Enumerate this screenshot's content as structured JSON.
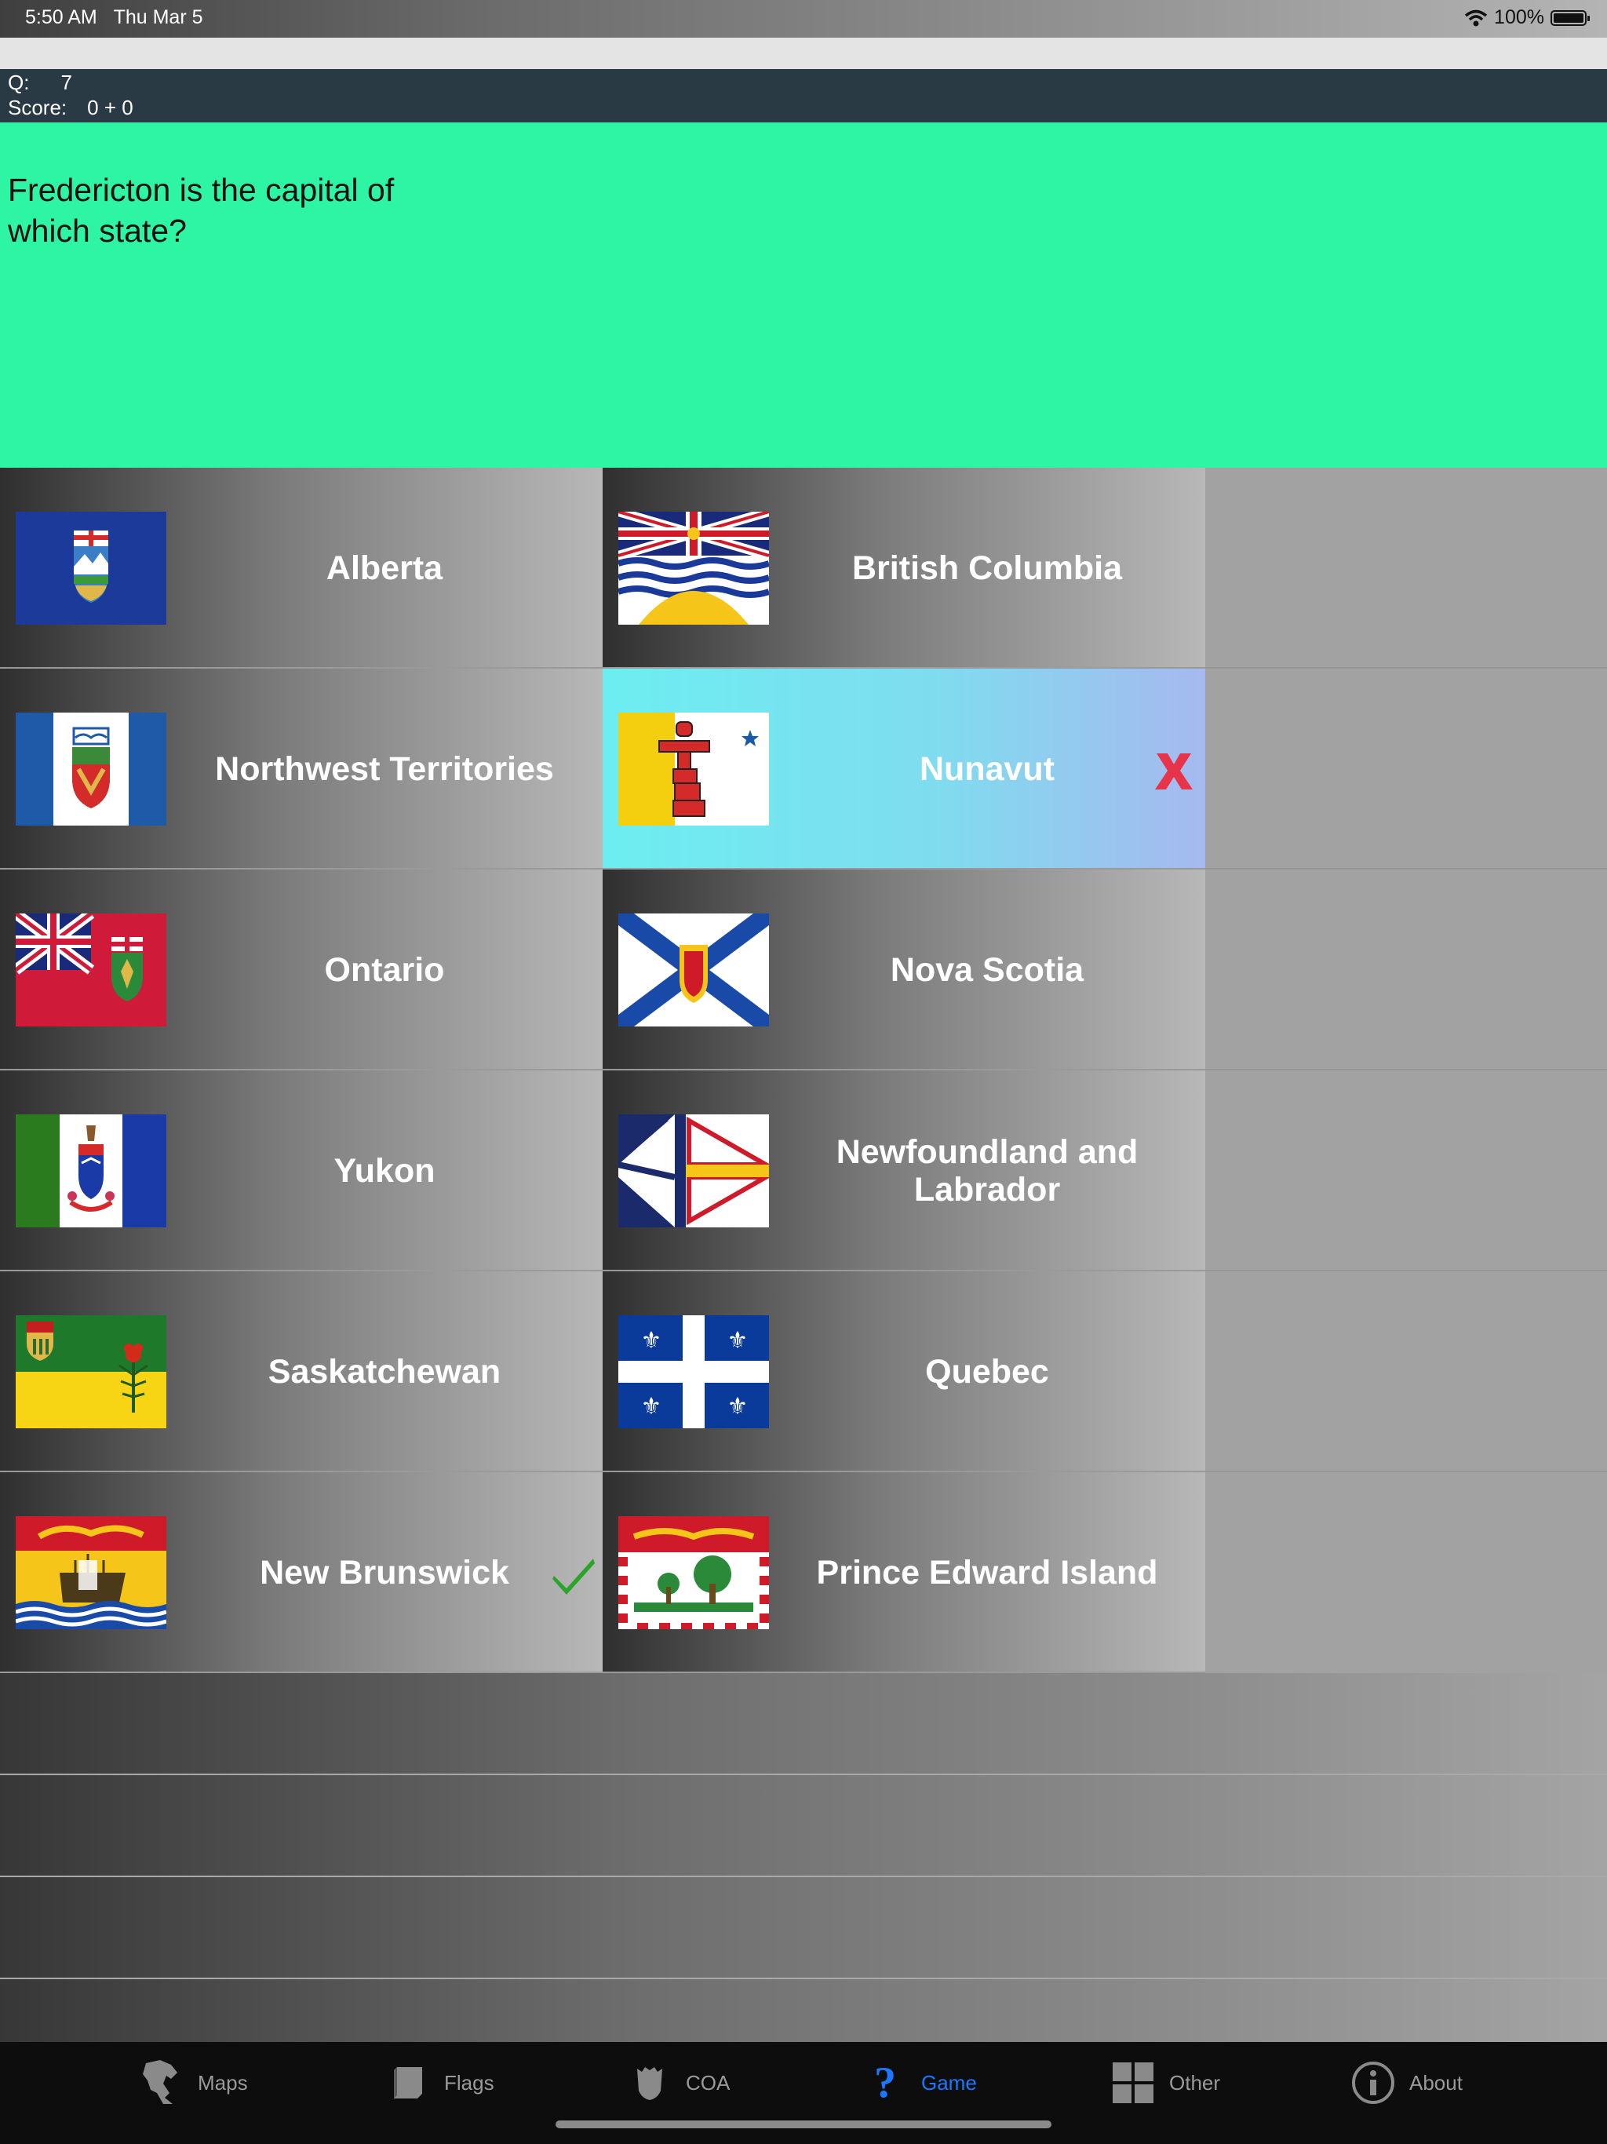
{
  "status_bar": {
    "time": "5:50 AM",
    "date": "Thu Mar 5",
    "battery": "100%"
  },
  "score": {
    "q_label": "Q:",
    "q_value": "7",
    "score_label": "Score:",
    "score_value": "0 + 0"
  },
  "question": "Fredericton is the capital of which state?",
  "answers": {
    "left": [
      {
        "label": "Alberta",
        "flag": "alberta-flag"
      },
      {
        "label": "Northwest Territories",
        "flag": "northwest-territories-flag"
      },
      {
        "label": "Ontario",
        "flag": "ontario-flag"
      },
      {
        "label": "Yukon",
        "flag": "yukon-flag"
      },
      {
        "label": "Saskatchewan",
        "flag": "saskatchewan-flag"
      },
      {
        "label": "New Brunswick",
        "flag": "new-brunswick-flag",
        "mark": "correct"
      }
    ],
    "right": [
      {
        "label": "British Columbia",
        "flag": "british-columbia-flag"
      },
      {
        "label": "Nunavut",
        "flag": "nunavut-flag",
        "mark": "wrong",
        "selected": true
      },
      {
        "label": "Nova Scotia",
        "flag": "nova-scotia-flag"
      },
      {
        "label": "Newfoundland and Labrador",
        "flag": "newfoundland-flag"
      },
      {
        "label": "Quebec",
        "flag": "quebec-flag"
      },
      {
        "label": "Prince Edward Island",
        "flag": "pei-flag"
      }
    ]
  },
  "tabs": [
    {
      "label": "Maps",
      "icon": "map-icon"
    },
    {
      "label": "Flags",
      "icon": "flag-icon"
    },
    {
      "label": "COA",
      "icon": "shield-icon"
    },
    {
      "label": "Game",
      "icon": "question-icon",
      "active": true
    },
    {
      "label": "Other",
      "icon": "grid-icon"
    },
    {
      "label": "About",
      "icon": "info-icon"
    }
  ],
  "colors": {
    "question_bg": "#2ef5a3",
    "score_bg": "#2a3a45",
    "active_tab": "#1a78ff",
    "wrong": "#e8344a",
    "correct": "#2aa52a"
  }
}
